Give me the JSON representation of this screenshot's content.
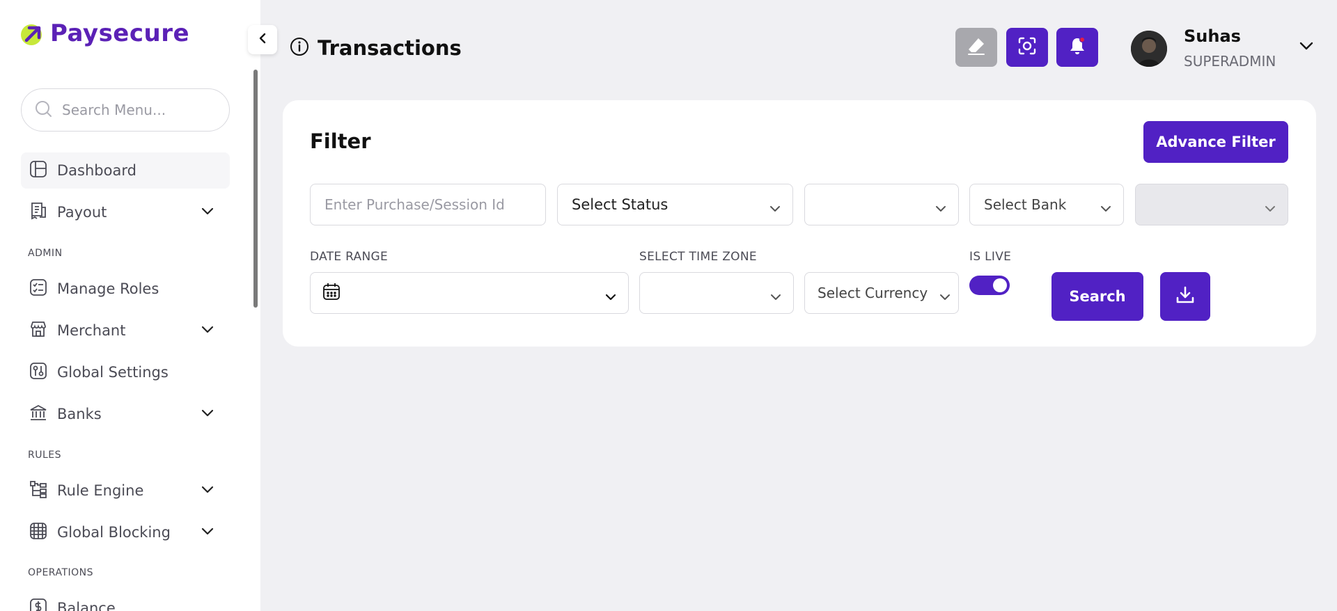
{
  "brand": {
    "name": "Paysecure",
    "accent": "#5121c4",
    "logo_mark_color": "#c7e83a"
  },
  "sidebar": {
    "search_placeholder": "Search Menu...",
    "items": [
      {
        "label": "Dashboard",
        "icon": "dashboard-icon",
        "active": true
      },
      {
        "label": "Payout",
        "icon": "receipt-icon",
        "expandable": true
      },
      {
        "label": "Manage Roles",
        "icon": "checklist-icon"
      },
      {
        "label": "Merchant",
        "icon": "store-icon",
        "expandable": true
      },
      {
        "label": "Global Settings",
        "icon": "settings-sliders-icon"
      },
      {
        "label": "Banks",
        "icon": "bank-icon",
        "expandable": true
      },
      {
        "label": "Rule Engine",
        "icon": "hierarchy-icon",
        "expandable": true
      },
      {
        "label": "Global Blocking",
        "icon": "globe-block-icon",
        "expandable": true
      },
      {
        "label": "Balance",
        "icon": "dollar-icon"
      }
    ],
    "sections": {
      "admin": "ADMIN",
      "rules": "RULES",
      "operations": "OPERATIONS"
    }
  },
  "header": {
    "title": "Transactions",
    "user": {
      "name": "Suhas",
      "role": "SUPERADMIN"
    }
  },
  "filter": {
    "title": "Filter",
    "advance_label": "Advance Filter",
    "purchase_placeholder": "Enter Purchase/Session Id",
    "status_value": "Select Status",
    "bank_value": "Select Bank",
    "labels": {
      "date_range": "DATE RANGE",
      "time_zone": "SELECT TIME ZONE",
      "is_live": "IS LIVE"
    },
    "currency_value": "Select Currency",
    "is_live": true,
    "search_label": "Search"
  }
}
